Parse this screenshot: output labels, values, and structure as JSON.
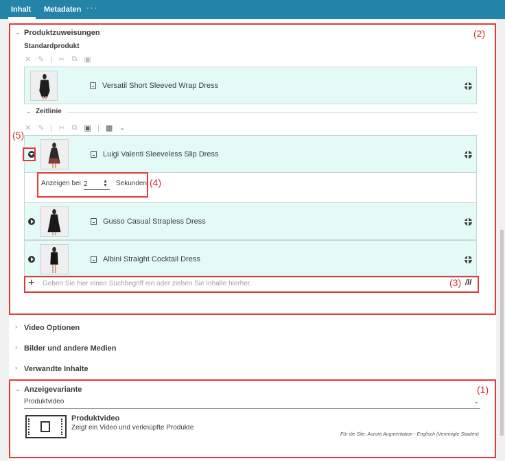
{
  "tabs": {
    "content": "Inhalt",
    "metadata": "Metadaten",
    "more": "···"
  },
  "product_assignments": {
    "title": "Produktzuweisungen",
    "standard_label": "Standardprodukt",
    "standard_item": "Versatil Short Sleeved Wrap Dress",
    "timeline_label": "Zeitlinie",
    "timeline_items": [
      "Luigi Valenti Sleeveless Slip Dress",
      "Gusso Casual Strapless Dress",
      "Albini Straight Cocktail Dress"
    ],
    "show_at_label": "Anzeigen bei",
    "show_at_value": "2",
    "seconds_label": "Sekunden",
    "search_placeholder": "Geben Sie hier einen Suchbegriff ein oder ziehen Sie Inhalte hierher."
  },
  "collapsed_sections": [
    "Video Optionen",
    "Bilder und andere Medien",
    "Verwandte Inhalte"
  ],
  "display_variant": {
    "title": "Anzeigevariante",
    "selected": "Produktvideo",
    "card_title": "Produktvideo",
    "card_desc": "Zeigt ein Video und verknüpfte Produkte",
    "site_note": "Für die Site: Aurora Augmentation - Englisch (Vereinigte Staaten)"
  },
  "annotations": {
    "one": "(1)",
    "two": "(2)",
    "three": "(3)",
    "four": "(4)",
    "five": "(5)"
  },
  "colors": {
    "topbar": "#2384a8",
    "item_bg": "#e3faf6",
    "annotation": "#e53935"
  }
}
